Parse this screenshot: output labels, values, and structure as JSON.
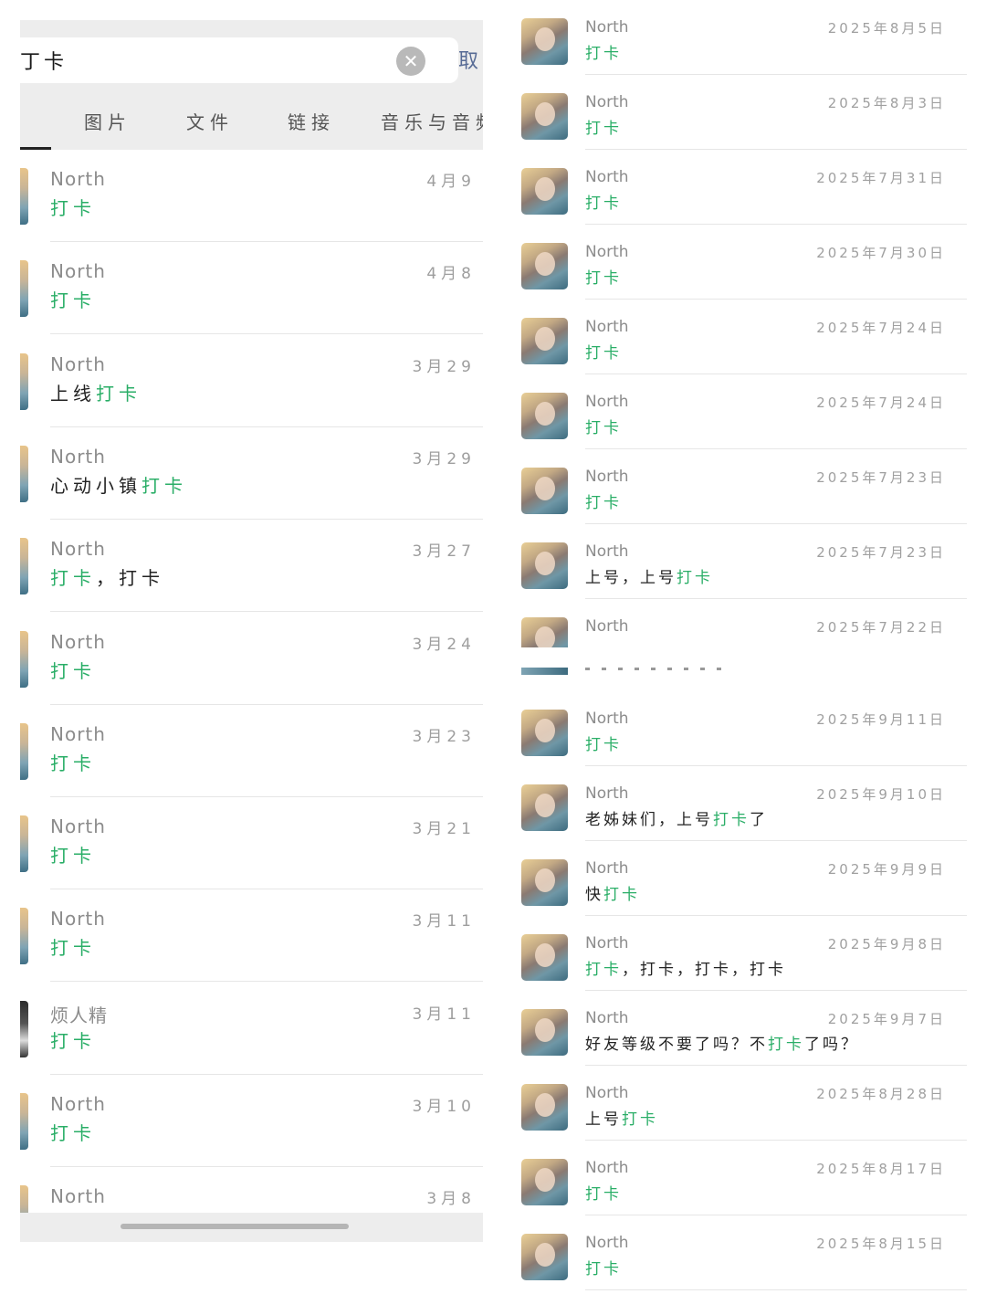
{
  "search": {
    "query": "打卡",
    "visible_query": "丁卡",
    "cancel_label": "取",
    "clear_icon": "close-circle-icon"
  },
  "filter_tabs": [
    "图片",
    "文件",
    "链接",
    "音乐与音频"
  ],
  "left_results": [
    {
      "name": "North",
      "date": "4月9",
      "parts": [
        {
          "t": "打卡",
          "hl": true
        }
      ]
    },
    {
      "name": "North",
      "date": "4月8",
      "parts": [
        {
          "t": "打卡",
          "hl": true
        }
      ]
    },
    {
      "name": "North",
      "date": "3月29",
      "parts": [
        {
          "t": "上线",
          "hl": false
        },
        {
          "t": "打卡",
          "hl": true
        }
      ]
    },
    {
      "name": "North",
      "date": "3月29",
      "parts": [
        {
          "t": "心动小镇",
          "hl": false
        },
        {
          "t": "打卡",
          "hl": true
        }
      ]
    },
    {
      "name": "North",
      "date": "3月27",
      "parts": [
        {
          "t": "打卡",
          "hl": true
        },
        {
          "t": "，打卡",
          "hl": false
        }
      ]
    },
    {
      "name": "North",
      "date": "3月24",
      "parts": [
        {
          "t": "打卡",
          "hl": true
        }
      ]
    },
    {
      "name": "North",
      "date": "3月23",
      "parts": [
        {
          "t": "打卡",
          "hl": true
        }
      ]
    },
    {
      "name": "North",
      "date": "3月21",
      "parts": [
        {
          "t": "打卡",
          "hl": true
        }
      ]
    },
    {
      "name": "North",
      "date": "3月11",
      "parts": [
        {
          "t": "打卡",
          "hl": true
        }
      ]
    },
    {
      "name": "烦人精",
      "date": "3月11",
      "parts": [
        {
          "t": "打卡",
          "hl": true
        }
      ],
      "avatar": "dark"
    },
    {
      "name": "North",
      "date": "3月10",
      "parts": [
        {
          "t": "打卡",
          "hl": true
        }
      ]
    },
    {
      "name": "North",
      "date": "3月8",
      "parts": []
    }
  ],
  "right_results_top": [
    {
      "name": "North",
      "date": "2025年8月5日",
      "parts": [
        {
          "t": "打卡",
          "hl": true
        }
      ]
    },
    {
      "name": "North",
      "date": "2025年8月3日",
      "parts": [
        {
          "t": "打卡",
          "hl": true
        }
      ]
    },
    {
      "name": "North",
      "date": "2025年7月31日",
      "parts": [
        {
          "t": "打卡",
          "hl": true
        }
      ]
    },
    {
      "name": "North",
      "date": "2025年7月30日",
      "parts": [
        {
          "t": "打卡",
          "hl": true
        }
      ]
    },
    {
      "name": "North",
      "date": "2025年7月24日",
      "parts": [
        {
          "t": "打卡",
          "hl": true
        }
      ]
    },
    {
      "name": "North",
      "date": "2025年7月24日",
      "parts": [
        {
          "t": "打卡",
          "hl": true
        }
      ]
    },
    {
      "name": "North",
      "date": "2025年7月23日",
      "parts": [
        {
          "t": "打卡",
          "hl": true
        }
      ]
    },
    {
      "name": "North",
      "date": "2025年7月23日",
      "parts": [
        {
          "t": "上号，上号",
          "hl": false
        },
        {
          "t": "打卡",
          "hl": true
        }
      ]
    },
    {
      "name": "North",
      "date": "2025年7月22日",
      "parts": []
    }
  ],
  "right_results_bottom": [
    {
      "name": "North",
      "date": "2025年9月11日",
      "parts": [
        {
          "t": "打卡",
          "hl": true
        }
      ]
    },
    {
      "name": "North",
      "date": "2025年9月10日",
      "parts": [
        {
          "t": "老姊妹们，上号",
          "hl": false
        },
        {
          "t": "打卡",
          "hl": true
        },
        {
          "t": "了",
          "hl": false
        }
      ]
    },
    {
      "name": "North",
      "date": "2025年9月9日",
      "parts": [
        {
          "t": "快",
          "hl": false
        },
        {
          "t": "打卡",
          "hl": true
        }
      ]
    },
    {
      "name": "North",
      "date": "2025年9月8日",
      "parts": [
        {
          "t": "打卡",
          "hl": true
        },
        {
          "t": "，打卡，打卡，打卡",
          "hl": false
        }
      ]
    },
    {
      "name": "North",
      "date": "2025年9月7日",
      "parts": [
        {
          "t": "好友等级不要了吗？不",
          "hl": false
        },
        {
          "t": "打卡",
          "hl": true
        },
        {
          "t": "了吗？",
          "hl": false
        }
      ]
    },
    {
      "name": "North",
      "date": "2025年8月28日",
      "parts": [
        {
          "t": "上号",
          "hl": false
        },
        {
          "t": "打卡",
          "hl": true
        }
      ]
    },
    {
      "name": "North",
      "date": "2025年8月17日",
      "parts": [
        {
          "t": "打卡",
          "hl": true
        }
      ]
    },
    {
      "name": "North",
      "date": "2025年8月15日",
      "parts": [
        {
          "t": "打卡",
          "hl": true
        }
      ]
    }
  ],
  "colors": {
    "highlight": "#2aae67",
    "link": "#576b95",
    "bg_gray": "#ededed"
  }
}
